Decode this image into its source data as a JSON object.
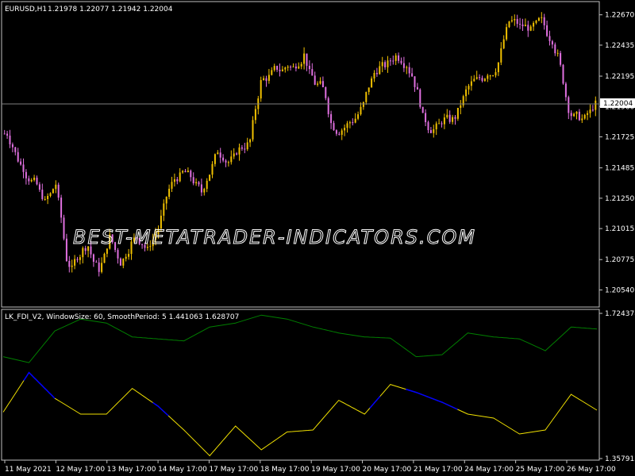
{
  "main_header": {
    "symbol": "EURUSD,H1",
    "values": "1.21978 1.22077 1.21942 1.22004"
  },
  "indicator_header": {
    "text": "LK_FDI_V2, WindowSize: 60, SmoothPeriod: 5  1.441063 1.628707"
  },
  "watermark": "BEST-METATRADER-INDICATORS.COM",
  "colors": {
    "background": "#000000",
    "frame": "#c0c0c0",
    "bull_candle": "#f0c000",
    "bear_candle": "#e070e0",
    "price_line": "#808080",
    "fdi_upper": "#008000",
    "fdi_lower_yellow": "#f0e000",
    "fdi_lower_blue": "#0000ff",
    "text": "#ffffff"
  },
  "chart_data": [
    {
      "type": "candlestick",
      "title": "EURUSD,H1",
      "y_ticks": [
        "1.22670",
        "1.22435",
        "1.22195",
        "1.21960",
        "1.21725",
        "1.21485",
        "1.21250",
        "1.21015",
        "1.20775",
        "1.20540"
      ],
      "ylim": [
        1.2042,
        1.2276
      ],
      "current_price_label": "1.22004",
      "current_price": 1.22004,
      "price_path": [
        1.2175,
        1.2165,
        1.2155,
        1.2148,
        1.214,
        1.2138,
        1.213,
        1.2122,
        1.2128,
        1.2136,
        1.211,
        1.2078,
        1.207,
        1.208,
        1.2085,
        1.2088,
        1.2076,
        1.207,
        1.208,
        1.2095,
        1.2085,
        1.2075,
        1.2082,
        1.209,
        1.2095,
        1.209,
        1.2085,
        1.2093,
        1.2102,
        1.2118,
        1.2132,
        1.214,
        1.2142,
        1.2145,
        1.2142,
        1.2135,
        1.213,
        1.214,
        1.215,
        1.2162,
        1.2157,
        1.2153,
        1.2157,
        1.2163,
        1.2165,
        1.217,
        1.2195,
        1.2215,
        1.2218,
        1.2222,
        1.2226,
        1.2224,
        1.2228,
        1.2226,
        1.223,
        1.2236,
        1.2222,
        1.2214,
        1.2213,
        1.2204,
        1.2183,
        1.2177,
        1.2178,
        1.2182,
        1.2185,
        1.219,
        1.2198,
        1.2212,
        1.2222,
        1.2226,
        1.2228,
        1.2232,
        1.2235,
        1.2232,
        1.2228,
        1.222,
        1.2207,
        1.2188,
        1.218,
        1.2178,
        1.2182,
        1.2186,
        1.2186,
        1.2188,
        1.2198,
        1.2208,
        1.2214,
        1.2217,
        1.2218,
        1.2222,
        1.2222,
        1.223,
        1.2248,
        1.2262,
        1.2262,
        1.2258,
        1.2258,
        1.2255,
        1.226,
        1.2263,
        1.2253,
        1.2247,
        1.2235,
        1.2216,
        1.2194,
        1.2188,
        1.2188,
        1.2187,
        1.2192,
        1.2198
      ],
      "x_ticks": [
        "11 May 2021",
        "12 May 17:00",
        "13 May 17:00",
        "14 May 17:00",
        "17 May 17:00",
        "18 May 17:00",
        "19 May 17:00",
        "20 May 17:00",
        "21 May 17:00",
        "24 May 17:00",
        "25 May 17:00",
        "26 May 17:00"
      ]
    },
    {
      "type": "line",
      "title": "LK_FDI_V2, WindowSize: 60, SmoothPeriod: 5",
      "y_ticks": [
        "1.724378",
        "1.357913"
      ],
      "ylim": [
        1.3579,
        1.7244
      ],
      "series": [
        {
          "color": "#008000",
          "x": [
            0,
            5,
            10,
            15,
            20,
            25,
            30,
            35,
            40,
            45,
            50,
            55,
            60,
            65,
            70,
            75,
            80,
            85,
            90,
            95,
            100,
            105,
            110,
            115
          ],
          "values": [
            1.615,
            1.6,
            1.68,
            1.71,
            1.7,
            1.665,
            1.66,
            1.655,
            1.69,
            1.7,
            1.72,
            1.71,
            1.69,
            1.675,
            1.665,
            1.662,
            1.615,
            1.62,
            1.675,
            1.665,
            1.66,
            1.63,
            1.69,
            1.685
          ]
        },
        {
          "color": "#f0e000",
          "x": [
            0,
            5,
            10,
            15,
            20,
            25,
            30,
            35,
            40,
            45,
            50,
            55,
            60,
            65,
            70,
            75,
            80,
            85,
            90,
            95,
            100,
            105,
            110,
            115
          ],
          "values": [
            1.475,
            1.575,
            1.51,
            1.47,
            1.47,
            1.535,
            1.49,
            1.43,
            1.365,
            1.44,
            1.38,
            1.425,
            1.43,
            1.505,
            1.47,
            1.545,
            1.525,
            1.5,
            1.47,
            1.46,
            1.42,
            1.43,
            1.52,
            1.48
          ],
          "blue_segments": [
            [
              4,
              10
            ],
            [
              29,
              32
            ],
            [
              71,
              73
            ],
            [
              78,
              88
            ]
          ]
        }
      ]
    }
  ]
}
